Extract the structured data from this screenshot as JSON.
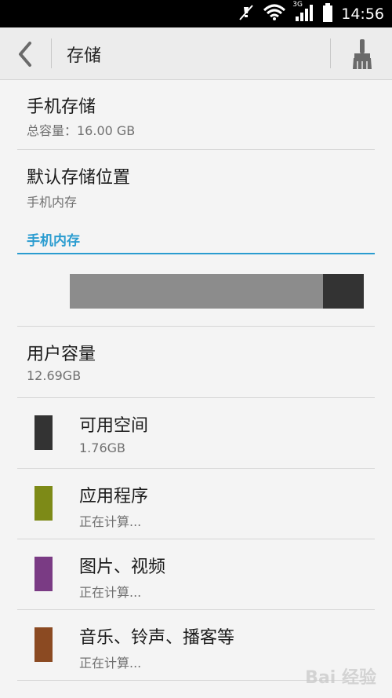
{
  "status_bar": {
    "time": "14:56",
    "network_type": "3G",
    "icons": [
      "mute-icon",
      "wifi-icon",
      "signal-icon",
      "battery-icon"
    ]
  },
  "action_bar": {
    "title": "存储",
    "back_icon": "back-arrow-icon",
    "clean_icon": "brush-icon"
  },
  "phone_storage": {
    "title": "手机存储",
    "subtitle": "总容量：16.00 GB"
  },
  "default_location": {
    "title": "默认存储位置",
    "subtitle": "手机内存"
  },
  "internal": {
    "section_header": "手机内存",
    "usage_free_fraction": 0.14,
    "user_capacity": {
      "title": "用户容量",
      "subtitle": "12.69GB"
    },
    "categories": [
      {
        "label": "可用空间",
        "value": "1.76GB",
        "color": "#333333"
      },
      {
        "label": "应用程序",
        "value": "正在计算...",
        "color": "#7d8a17"
      },
      {
        "label": "图片、视频",
        "value": "正在计算...",
        "color": "#7a3b84"
      },
      {
        "label": "音乐、铃声、播客等",
        "value": "正在计算...",
        "color": "#8b4a22"
      }
    ]
  },
  "colors": {
    "accent": "#2a9cd0",
    "used_bar": "#8c8c8c",
    "free_bar": "#333333"
  },
  "watermark": "Bai 经验"
}
